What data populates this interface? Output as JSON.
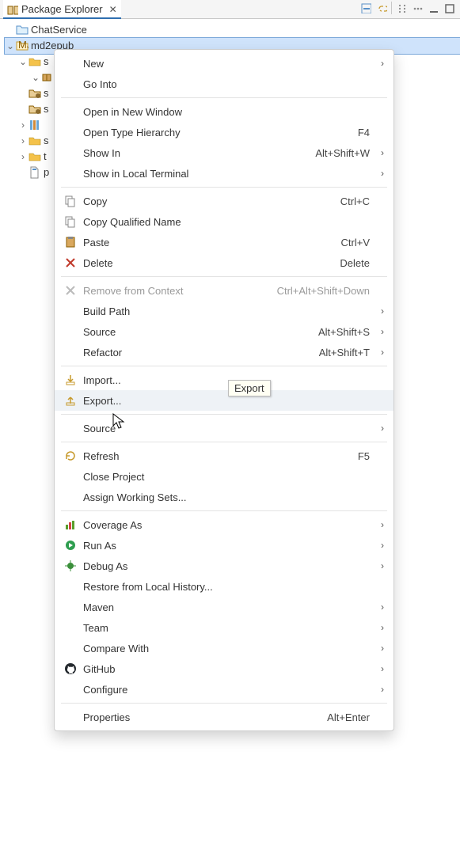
{
  "tab": {
    "title": "Package Explorer"
  },
  "toolbar": {
    "icons": [
      "collapse-icon",
      "link-icon",
      "filter-icon",
      "view-menu-icon",
      "min-icon",
      "max-icon"
    ]
  },
  "tree": {
    "items": [
      {
        "name": "ChatService",
        "depth": 0,
        "twisty": "",
        "icon": "project-closed"
      },
      {
        "name": "md2epub",
        "depth": 0,
        "twisty": "open",
        "icon": "java-project",
        "selected": true
      },
      {
        "name": "s",
        "depth": 1,
        "twisty": "open",
        "icon": "folder-pkg"
      },
      {
        "name": "",
        "depth": 2,
        "twisty": "open",
        "icon": "package"
      },
      {
        "name": "s",
        "depth": 1,
        "twisty": "",
        "icon": "folder-src"
      },
      {
        "name": "s",
        "depth": 1,
        "twisty": "",
        "icon": "folder-src"
      },
      {
        "name": "",
        "depth": 1,
        "twisty": "closed",
        "icon": "library"
      },
      {
        "name": "s",
        "depth": 1,
        "twisty": "closed",
        "icon": "folder"
      },
      {
        "name": "t",
        "depth": 1,
        "twisty": "closed",
        "icon": "folder"
      },
      {
        "name": "p",
        "depth": 1,
        "twisty": "",
        "icon": "file-xml"
      }
    ]
  },
  "tooltip": "Export",
  "menu": [
    {
      "label": "New",
      "sub": true
    },
    {
      "label": "Go Into"
    },
    {
      "sep": true
    },
    {
      "label": "Open in New Window"
    },
    {
      "label": "Open Type Hierarchy",
      "accel": "F4"
    },
    {
      "label": "Show In",
      "accel": "Alt+Shift+W",
      "sub": true
    },
    {
      "label": "Show in Local Terminal",
      "sub": true
    },
    {
      "sep": true
    },
    {
      "label": "Copy",
      "accel": "Ctrl+C",
      "icon": "copy"
    },
    {
      "label": "Copy Qualified Name",
      "icon": "copy"
    },
    {
      "label": "Paste",
      "accel": "Ctrl+V",
      "icon": "paste"
    },
    {
      "label": "Delete",
      "accel": "Delete",
      "icon": "delete"
    },
    {
      "sep": true
    },
    {
      "label": "Remove from Context",
      "accel": "Ctrl+Alt+Shift+Down",
      "icon": "remove",
      "disabled": true
    },
    {
      "label": "Build Path",
      "sub": true
    },
    {
      "label": "Source",
      "accel": "Alt+Shift+S",
      "sub": true
    },
    {
      "label": "Refactor",
      "accel": "Alt+Shift+T",
      "sub": true
    },
    {
      "sep": true
    },
    {
      "label": "Import...",
      "icon": "import"
    },
    {
      "label": "Export...",
      "icon": "export",
      "hover": true
    },
    {
      "sep": true
    },
    {
      "label": "Source",
      "sub": true
    },
    {
      "sep": true
    },
    {
      "label": "Refresh",
      "accel": "F5",
      "icon": "refresh"
    },
    {
      "label": "Close Project"
    },
    {
      "label": "Assign Working Sets..."
    },
    {
      "sep": true
    },
    {
      "label": "Coverage As",
      "sub": true,
      "icon": "coverage"
    },
    {
      "label": "Run As",
      "sub": true,
      "icon": "run"
    },
    {
      "label": "Debug As",
      "sub": true,
      "icon": "debug"
    },
    {
      "label": "Restore from Local History..."
    },
    {
      "label": "Maven",
      "sub": true
    },
    {
      "label": "Team",
      "sub": true
    },
    {
      "label": "Compare With",
      "sub": true
    },
    {
      "label": "GitHub",
      "sub": true,
      "icon": "github"
    },
    {
      "label": "Configure",
      "sub": true
    },
    {
      "sep": true
    },
    {
      "label": "Properties",
      "accel": "Alt+Enter"
    }
  ]
}
